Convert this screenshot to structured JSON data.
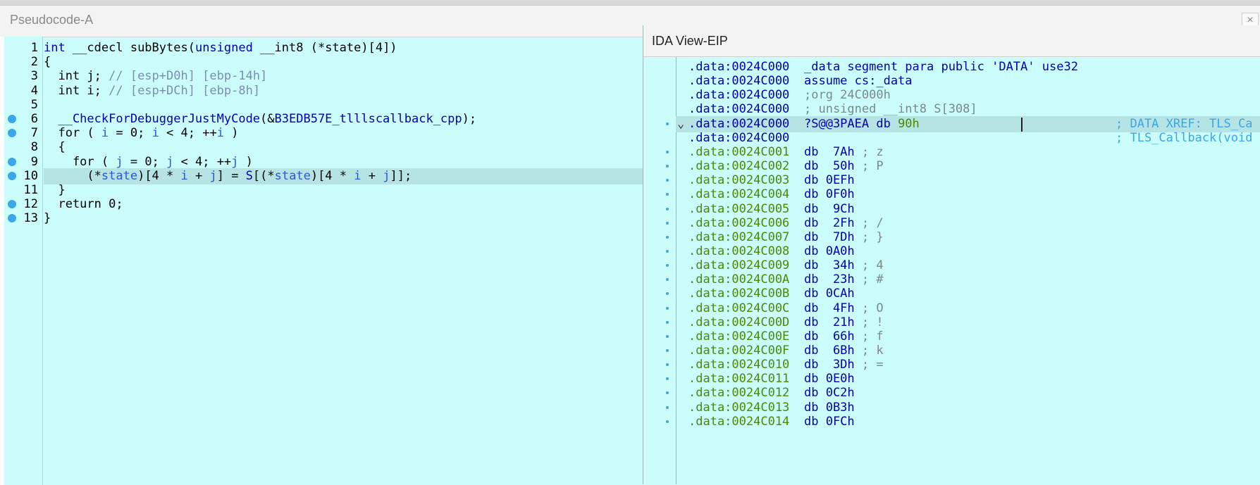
{
  "pseudo": {
    "title": "Pseudocode-A",
    "close_label": "×",
    "lines": [
      {
        "n": "1",
        "dot": false,
        "parts": [
          [
            "kw",
            "int "
          ],
          [
            "",
            "__cdecl subBytes("
          ],
          [
            "kw",
            "unsigned "
          ],
          [
            "",
            "__int8 (*state)[4])"
          ]
        ]
      },
      {
        "n": "2",
        "dot": false,
        "parts": [
          [
            "",
            "{"
          ]
        ]
      },
      {
        "n": "3",
        "dot": false,
        "parts": [
          [
            "",
            "  int j; "
          ],
          [
            "cm",
            "// [esp+D0h] [ebp-14h]"
          ]
        ]
      },
      {
        "n": "4",
        "dot": false,
        "parts": [
          [
            "",
            "  int i; "
          ],
          [
            "cm",
            "// [esp+DCh] [ebp-8h]"
          ]
        ]
      },
      {
        "n": "5",
        "dot": false,
        "parts": [
          [
            "",
            ""
          ]
        ]
      },
      {
        "n": "6",
        "dot": true,
        "parts": [
          [
            "kw",
            "  __CheckForDebuggerJustMyCode"
          ],
          [
            "",
            "(&"
          ],
          [
            "kw",
            "B3EDB57E_tlllscallback_cpp"
          ],
          [
            "",
            ");"
          ]
        ]
      },
      {
        "n": "7",
        "dot": true,
        "parts": [
          [
            "",
            "  for ( "
          ],
          [
            "var",
            "i"
          ],
          [
            "",
            " = 0; "
          ],
          [
            "var",
            "i"
          ],
          [
            "",
            " < 4; ++"
          ],
          [
            "var",
            "i"
          ],
          [
            "",
            " )"
          ]
        ]
      },
      {
        "n": "8",
        "dot": false,
        "parts": [
          [
            "",
            "  {"
          ]
        ]
      },
      {
        "n": "9",
        "dot": true,
        "parts": [
          [
            "",
            "    for ( "
          ],
          [
            "var",
            "j"
          ],
          [
            "",
            " = 0; "
          ],
          [
            "var",
            "j"
          ],
          [
            "",
            " < 4; ++"
          ],
          [
            "var",
            "j"
          ],
          [
            "",
            " )"
          ]
        ]
      },
      {
        "n": "10",
        "dot": true,
        "parts": [
          [
            "",
            "      (*"
          ],
          [
            "var",
            "state"
          ],
          [
            "",
            ")[4 * "
          ],
          [
            "var",
            "i"
          ],
          [
            "",
            " + "
          ],
          [
            "var",
            "j"
          ],
          [
            "",
            "] = "
          ],
          [
            "kw",
            "S"
          ],
          [
            "",
            "[(*"
          ],
          [
            "var",
            "state"
          ],
          [
            "",
            ")[4 * "
          ],
          [
            "var",
            "i"
          ],
          [
            "",
            " + "
          ],
          [
            "var",
            "j"
          ],
          [
            "",
            "]];"
          ]
        ]
      },
      {
        "n": "11",
        "dot": false,
        "parts": [
          [
            "",
            "  }"
          ]
        ]
      },
      {
        "n": "12",
        "dot": true,
        "parts": [
          [
            "",
            "  return 0;"
          ]
        ]
      },
      {
        "n": "13",
        "dot": true,
        "parts": [
          [
            "",
            "}"
          ]
        ]
      }
    ]
  },
  "ida": {
    "title": "IDA View-EIP",
    "lines": [
      {
        "addr": ".data:0024C000",
        "green": false,
        "dot": false,
        "rest": [
          [
            "",
            "_data segment para public 'DATA' use32"
          ]
        ]
      },
      {
        "addr": ".data:0024C000",
        "green": false,
        "dot": false,
        "rest": [
          [
            "",
            "assume cs:_data"
          ]
        ]
      },
      {
        "addr": ".data:0024C000",
        "green": false,
        "dot": false,
        "rest": [
          [
            "cmt",
            ";org 24C000h"
          ]
        ]
      },
      {
        "addr": ".data:0024C000",
        "green": false,
        "dot": false,
        "rest": [
          [
            "cmt",
            "; unsigned __int8 S[308]"
          ]
        ]
      },
      {
        "addr": ".data:0024C000",
        "green": false,
        "dot": true,
        "hl": true,
        "rest": [
          [
            "",
            "?S@@3PAEA db "
          ],
          [
            "kwg",
            "90h"
          ]
        ],
        "xref": "; DATA XREF: TLS_Ca"
      },
      {
        "addr": ".data:0024C000",
        "green": false,
        "dot": false,
        "rest": [],
        "xref": "; TLS_Callback(void"
      },
      {
        "addr": ".data:0024C001",
        "green": true,
        "dot": true,
        "rest": [
          [
            "",
            "db  7Ah "
          ],
          [
            "cmt",
            "; z"
          ]
        ]
      },
      {
        "addr": ".data:0024C002",
        "green": true,
        "dot": true,
        "rest": [
          [
            "",
            "db  50h "
          ],
          [
            "cmt",
            "; P"
          ]
        ]
      },
      {
        "addr": ".data:0024C003",
        "green": true,
        "dot": true,
        "rest": [
          [
            "",
            "db 0EFh"
          ]
        ]
      },
      {
        "addr": ".data:0024C004",
        "green": true,
        "dot": true,
        "rest": [
          [
            "",
            "db 0F0h"
          ]
        ]
      },
      {
        "addr": ".data:0024C005",
        "green": true,
        "dot": true,
        "rest": [
          [
            "",
            "db  9Ch"
          ]
        ]
      },
      {
        "addr": ".data:0024C006",
        "green": true,
        "dot": true,
        "rest": [
          [
            "",
            "db  2Fh "
          ],
          [
            "cmt",
            "; /"
          ]
        ]
      },
      {
        "addr": ".data:0024C007",
        "green": true,
        "dot": true,
        "rest": [
          [
            "",
            "db  7Dh "
          ],
          [
            "cmt",
            "; }"
          ]
        ]
      },
      {
        "addr": ".data:0024C008",
        "green": true,
        "dot": true,
        "rest": [
          [
            "",
            "db 0A0h"
          ]
        ]
      },
      {
        "addr": ".data:0024C009",
        "green": true,
        "dot": true,
        "rest": [
          [
            "",
            "db  34h "
          ],
          [
            "cmt",
            "; 4"
          ]
        ]
      },
      {
        "addr": ".data:0024C00A",
        "green": true,
        "dot": true,
        "rest": [
          [
            "",
            "db  23h "
          ],
          [
            "cmt",
            "; #"
          ]
        ]
      },
      {
        "addr": ".data:0024C00B",
        "green": true,
        "dot": true,
        "rest": [
          [
            "",
            "db 0CAh"
          ]
        ]
      },
      {
        "addr": ".data:0024C00C",
        "green": true,
        "dot": true,
        "rest": [
          [
            "",
            "db  4Fh "
          ],
          [
            "cmt",
            "; O"
          ]
        ]
      },
      {
        "addr": ".data:0024C00D",
        "green": true,
        "dot": true,
        "rest": [
          [
            "",
            "db  21h "
          ],
          [
            "cmt",
            "; !"
          ]
        ]
      },
      {
        "addr": ".data:0024C00E",
        "green": true,
        "dot": true,
        "rest": [
          [
            "",
            "db  66h "
          ],
          [
            "cmt",
            "; f"
          ]
        ]
      },
      {
        "addr": ".data:0024C00F",
        "green": true,
        "dot": true,
        "rest": [
          [
            "",
            "db  6Bh "
          ],
          [
            "cmt",
            "; k"
          ]
        ]
      },
      {
        "addr": ".data:0024C010",
        "green": true,
        "dot": true,
        "rest": [
          [
            "",
            "db  3Dh "
          ],
          [
            "cmt",
            "; ="
          ]
        ]
      },
      {
        "addr": ".data:0024C011",
        "green": true,
        "dot": true,
        "rest": [
          [
            "",
            "db 0E0h"
          ]
        ]
      },
      {
        "addr": ".data:0024C012",
        "green": true,
        "dot": true,
        "rest": [
          [
            "",
            "db 0C2h"
          ]
        ]
      },
      {
        "addr": ".data:0024C013",
        "green": true,
        "dot": true,
        "rest": [
          [
            "",
            "db 0B3h"
          ]
        ]
      },
      {
        "addr": ".data:0024C014",
        "green": true,
        "dot": true,
        "rest": [
          [
            "",
            "db 0FCh"
          ]
        ]
      }
    ]
  },
  "colors": {
    "bg": "#ccfdfd",
    "keyword": "#0000b0",
    "address_green": "#4a8a00",
    "breakpoint": "#3aa7e6"
  }
}
